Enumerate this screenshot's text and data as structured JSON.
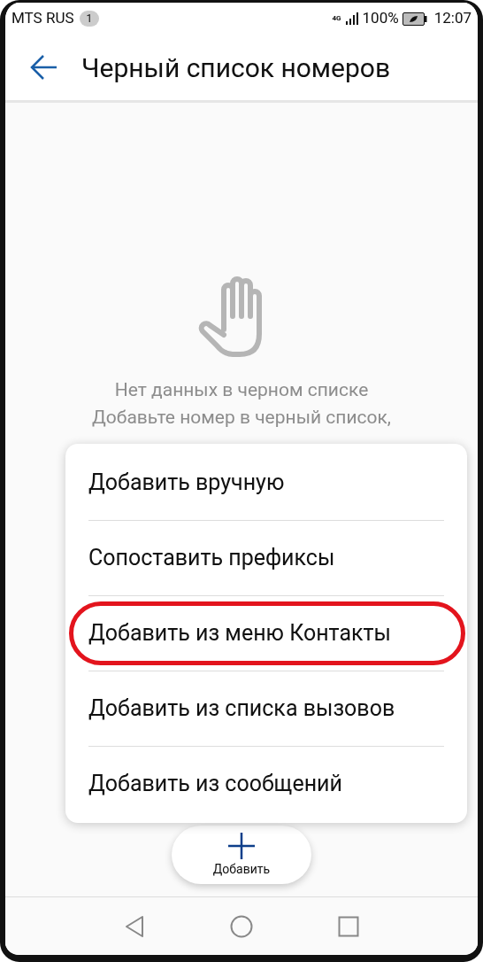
{
  "status_bar": {
    "carrier": "MTS RUS",
    "notification_count": "1",
    "network": "4G",
    "battery": "100%",
    "time": "12:07"
  },
  "header": {
    "title": "Черный список номеров"
  },
  "empty_state": {
    "title": "Нет данных в черном списке",
    "lines": [
      "Добавьте номер в черный список,"
    ]
  },
  "menu": {
    "items": [
      {
        "label": "Добавить вручную",
        "highlighted": false
      },
      {
        "label": "Сопоставить префиксы",
        "highlighted": false
      },
      {
        "label": "Добавить из меню Контакты",
        "highlighted": true
      },
      {
        "label": "Добавить из списка вызовов",
        "highlighted": false
      },
      {
        "label": "Добавить из сообщений",
        "highlighted": false
      }
    ]
  },
  "add_button": {
    "label": "Добавить"
  }
}
